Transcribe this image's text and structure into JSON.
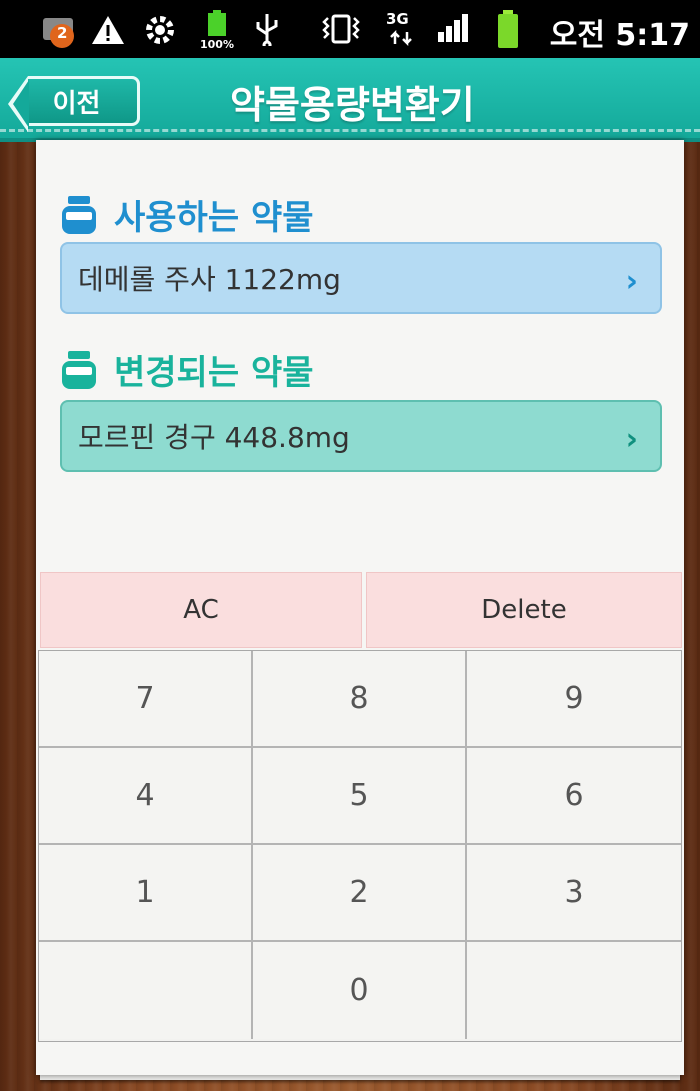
{
  "status_bar": {
    "notification_count": "2",
    "battery_text": "100%",
    "network_text": "3G",
    "time": "오전 5:17"
  },
  "header": {
    "back_label": "이전",
    "title": "약물용량변환기"
  },
  "source_drug": {
    "label": "사용하는 약물",
    "value": "데메롤 주사  1122mg"
  },
  "target_drug": {
    "label": "변경되는 약물",
    "value": "모르핀 경구  448.8mg"
  },
  "keypad": {
    "ac_label": "AC",
    "delete_label": "Delete",
    "keys": [
      "7",
      "8",
      "9",
      "4",
      "5",
      "6",
      "1",
      "2",
      "3",
      "",
      "0",
      ""
    ]
  },
  "colors": {
    "header": "#14a99a",
    "source_field": "#b5dbf3",
    "target_field": "#8edbd0",
    "source_accent": "#1f8fcf",
    "target_accent": "#19b39c",
    "keypad_action": "#fadede"
  }
}
